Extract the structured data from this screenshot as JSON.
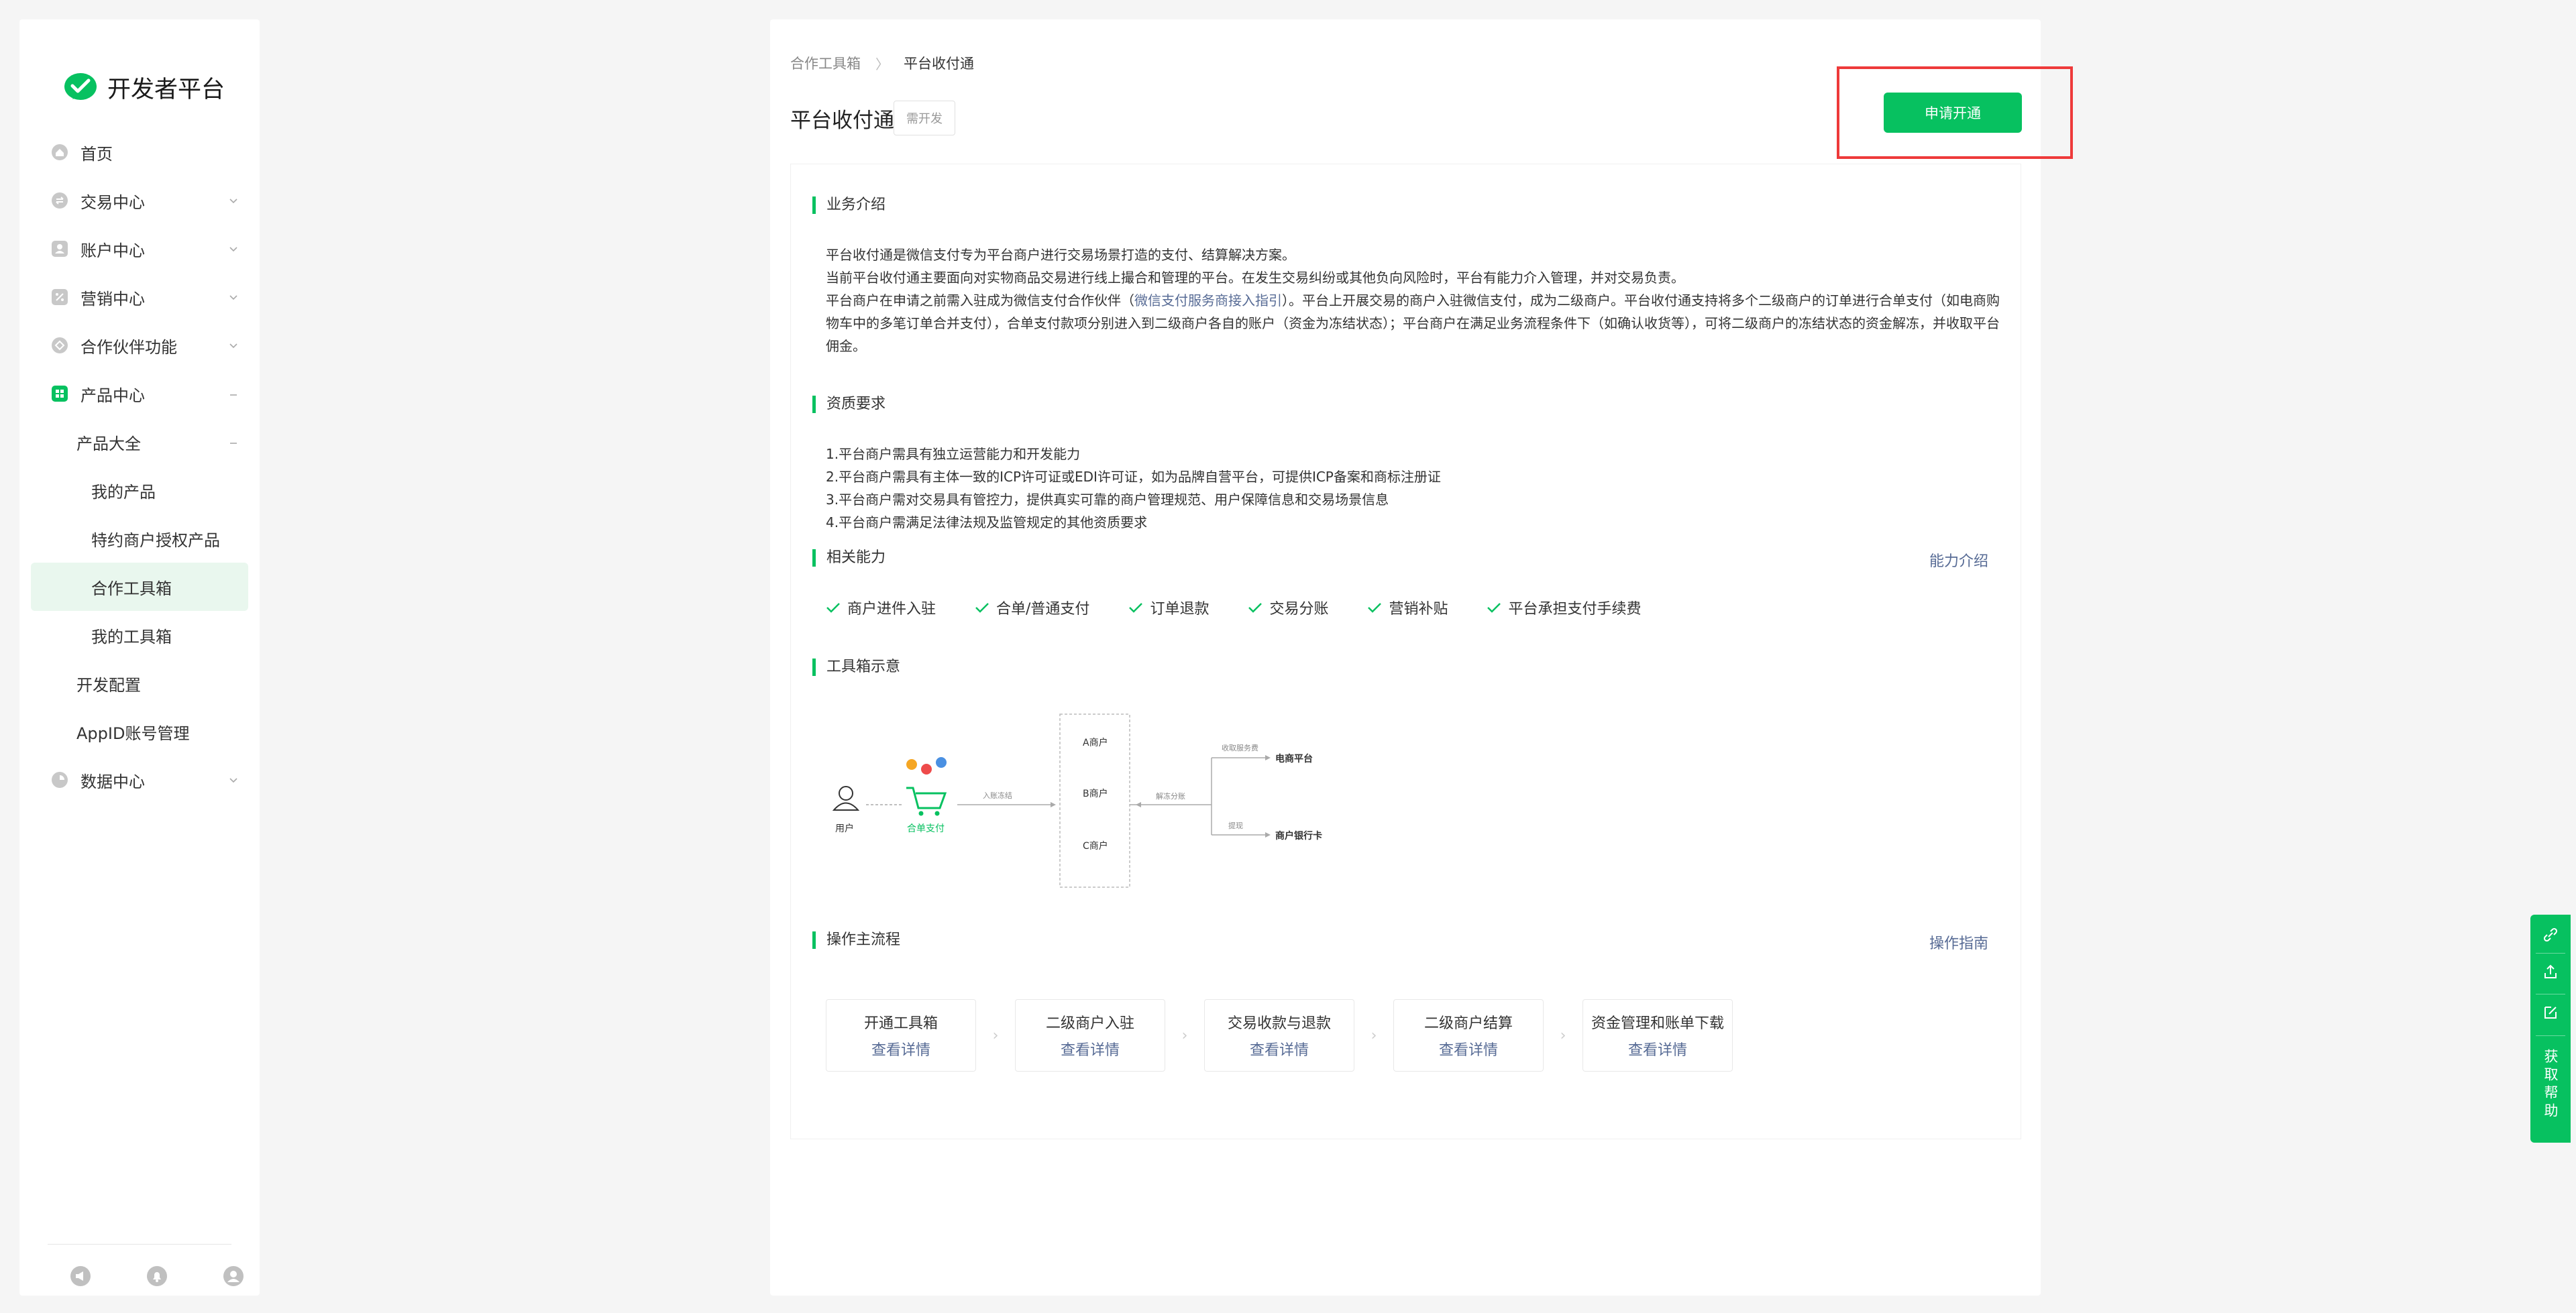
{
  "sidebar": {
    "brand": "开发者平台",
    "items": [
      {
        "label": "首页"
      },
      {
        "label": "交易中心"
      },
      {
        "label": "账户中心"
      },
      {
        "label": "营销中心"
      },
      {
        "label": "合作伙伴功能"
      },
      {
        "label": "产品中心"
      },
      {
        "label": "产品大全"
      },
      {
        "label": "我的产品"
      },
      {
        "label": "特约商户授权产品"
      },
      {
        "label": "合作工具箱"
      },
      {
        "label": "我的工具箱"
      },
      {
        "label": "开发配置"
      },
      {
        "label": "AppID账号管理"
      },
      {
        "label": "数据中心"
      }
    ]
  },
  "breadcrumb": {
    "parent": "合作工具箱",
    "separator": "〉",
    "current": "平台收付通"
  },
  "header": {
    "title": "平台收付通",
    "tag": "需开发",
    "apply_button": "申请开通"
  },
  "intro": {
    "title": "业务介绍",
    "line1": "平台收付通是微信支付专为平台商户进行交易场景打造的支付、结算解决方案。",
    "line2": "当前平台收付通主要面向对实物商品交易进行线上撮合和管理的平台。在发生交易纠纷或其他负向风险时，平台有能力介入管理，并对交易负责。",
    "line3_a": "平台商户在申请之前需入驻成为微信支付合作伙伴（",
    "line3_link": "微信支付服务商接入指引",
    "line3_b": "）。平台上开展交易的商户入驻微信支付，成为二级商户。平台收付通支持将多个二级商户的订单进行合单支付（如电商购物车中的多笔订单合并支付），合单支付款项分别进入到二级商户各自的账户（资金为冻结状态）；平台商户在满足业务流程条件下（如确认收货等），可将二级商户的冻结状态的资金解冻，并收取平台佣金。"
  },
  "qualification": {
    "title": "资质要求",
    "items": [
      "1.平台商户需具有独立运营能力和开发能力",
      "2.平台商户需具有主体一致的ICP许可证或EDI许可证，如为品牌自营平台，可提供ICP备案和商标注册证",
      "3.平台商户需对交易具有管控力，提供真实可靠的商户管理规范、用户保障信息和交易场景信息",
      "4.平台商户需满足法律法规及监管规定的其他资质要求"
    ]
  },
  "capabilities": {
    "title": "相关能力",
    "link": "能力介绍",
    "items": [
      "商户进件入驻",
      "合单/普通支付",
      "订单退款",
      "交易分账",
      "营销补贴",
      "平台承担支付手续费"
    ]
  },
  "diagram": {
    "title": "工具箱示意",
    "user": "用户",
    "combined_pay": "合单支付",
    "freeze_label": "入账冻结",
    "merchants": [
      "A商户",
      "B商户",
      "C商户"
    ],
    "unfreeze_label": "解冻分账",
    "fee_label": "收取服务费",
    "platform": "电商平台",
    "withdraw_label": "提现",
    "bank_card": "商户银行卡"
  },
  "flow": {
    "title": "操作主流程",
    "link": "操作指南",
    "detail_label": "查看详情",
    "steps": [
      {
        "title": "开通工具箱"
      },
      {
        "title": "二级商户入驻"
      },
      {
        "title": "交易收款与退款"
      },
      {
        "title": "二级商户结算"
      },
      {
        "title": "资金管理和账单下载"
      }
    ]
  },
  "float_bar": {
    "help_text": "获取帮助"
  },
  "colors": {
    "brand_green": "#07c160",
    "link_blue": "#576b95",
    "highlight_red": "#ee3a3a"
  }
}
